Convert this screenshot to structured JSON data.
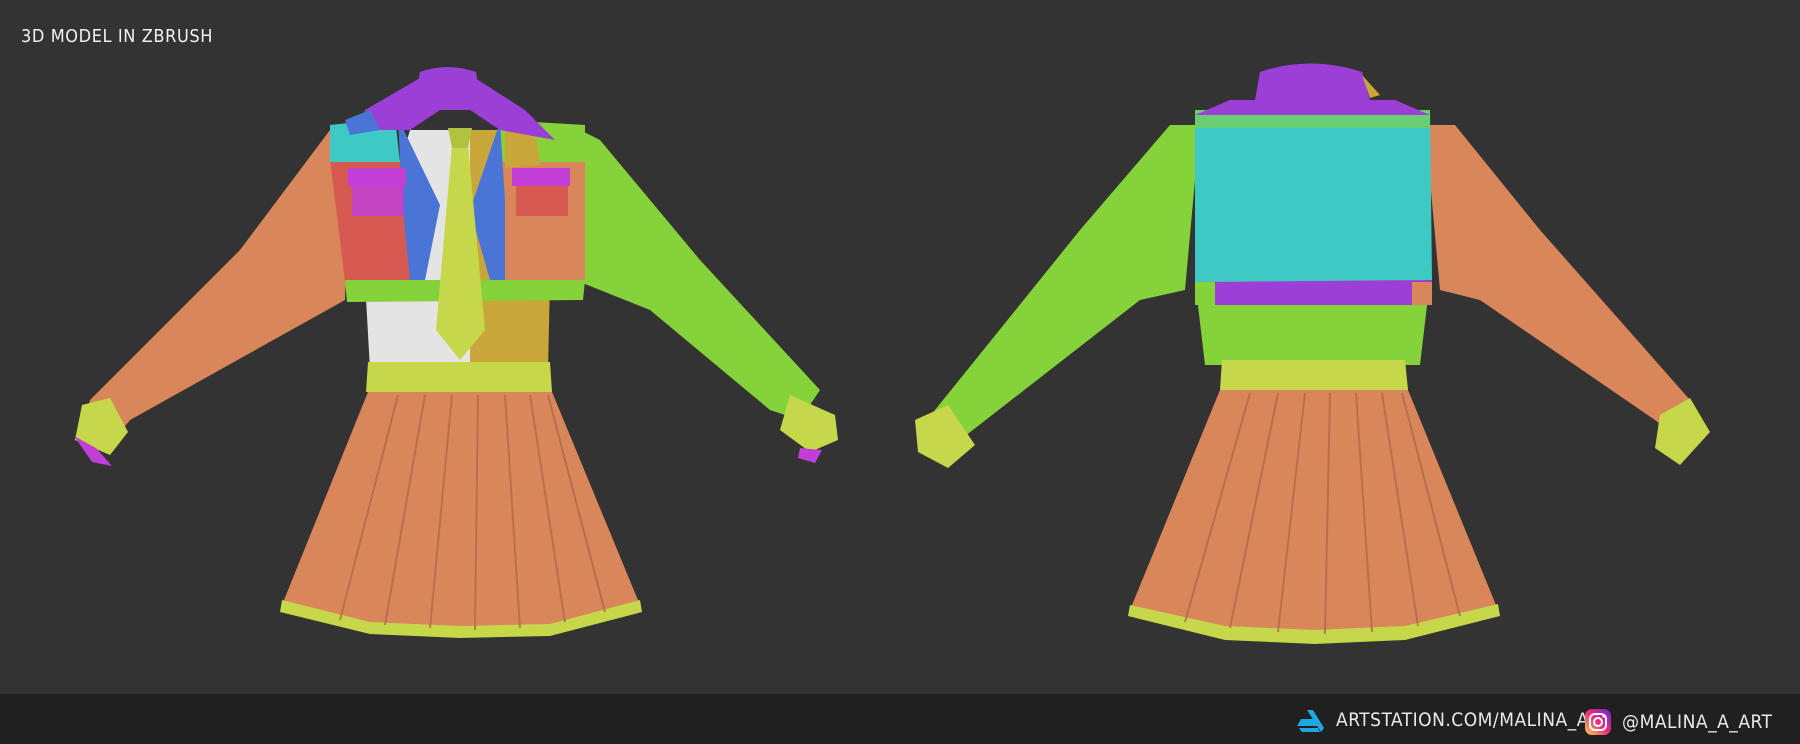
{
  "title": "3D MODEL IN ZBRUSH",
  "footer": {
    "artstation": {
      "icon": "artstation-icon",
      "text": "ARTSTATION.COM/MALINA_A",
      "color": "#1fa7e1"
    },
    "instagram": {
      "icon": "instagram-icon",
      "text": "@MALINA_A_ART"
    }
  },
  "palette": {
    "background": "#333333",
    "footer": "#202020",
    "orange": "#d9875a",
    "green": "#86d23a",
    "cyan": "#3fc9c4",
    "purple": "#9b3fd6",
    "magenta": "#c13fd6",
    "red": "#d65a52",
    "yellow": "#c6d84a",
    "blue": "#4a74d6",
    "white": "#e4e4e4",
    "mustard": "#c9a63a"
  }
}
